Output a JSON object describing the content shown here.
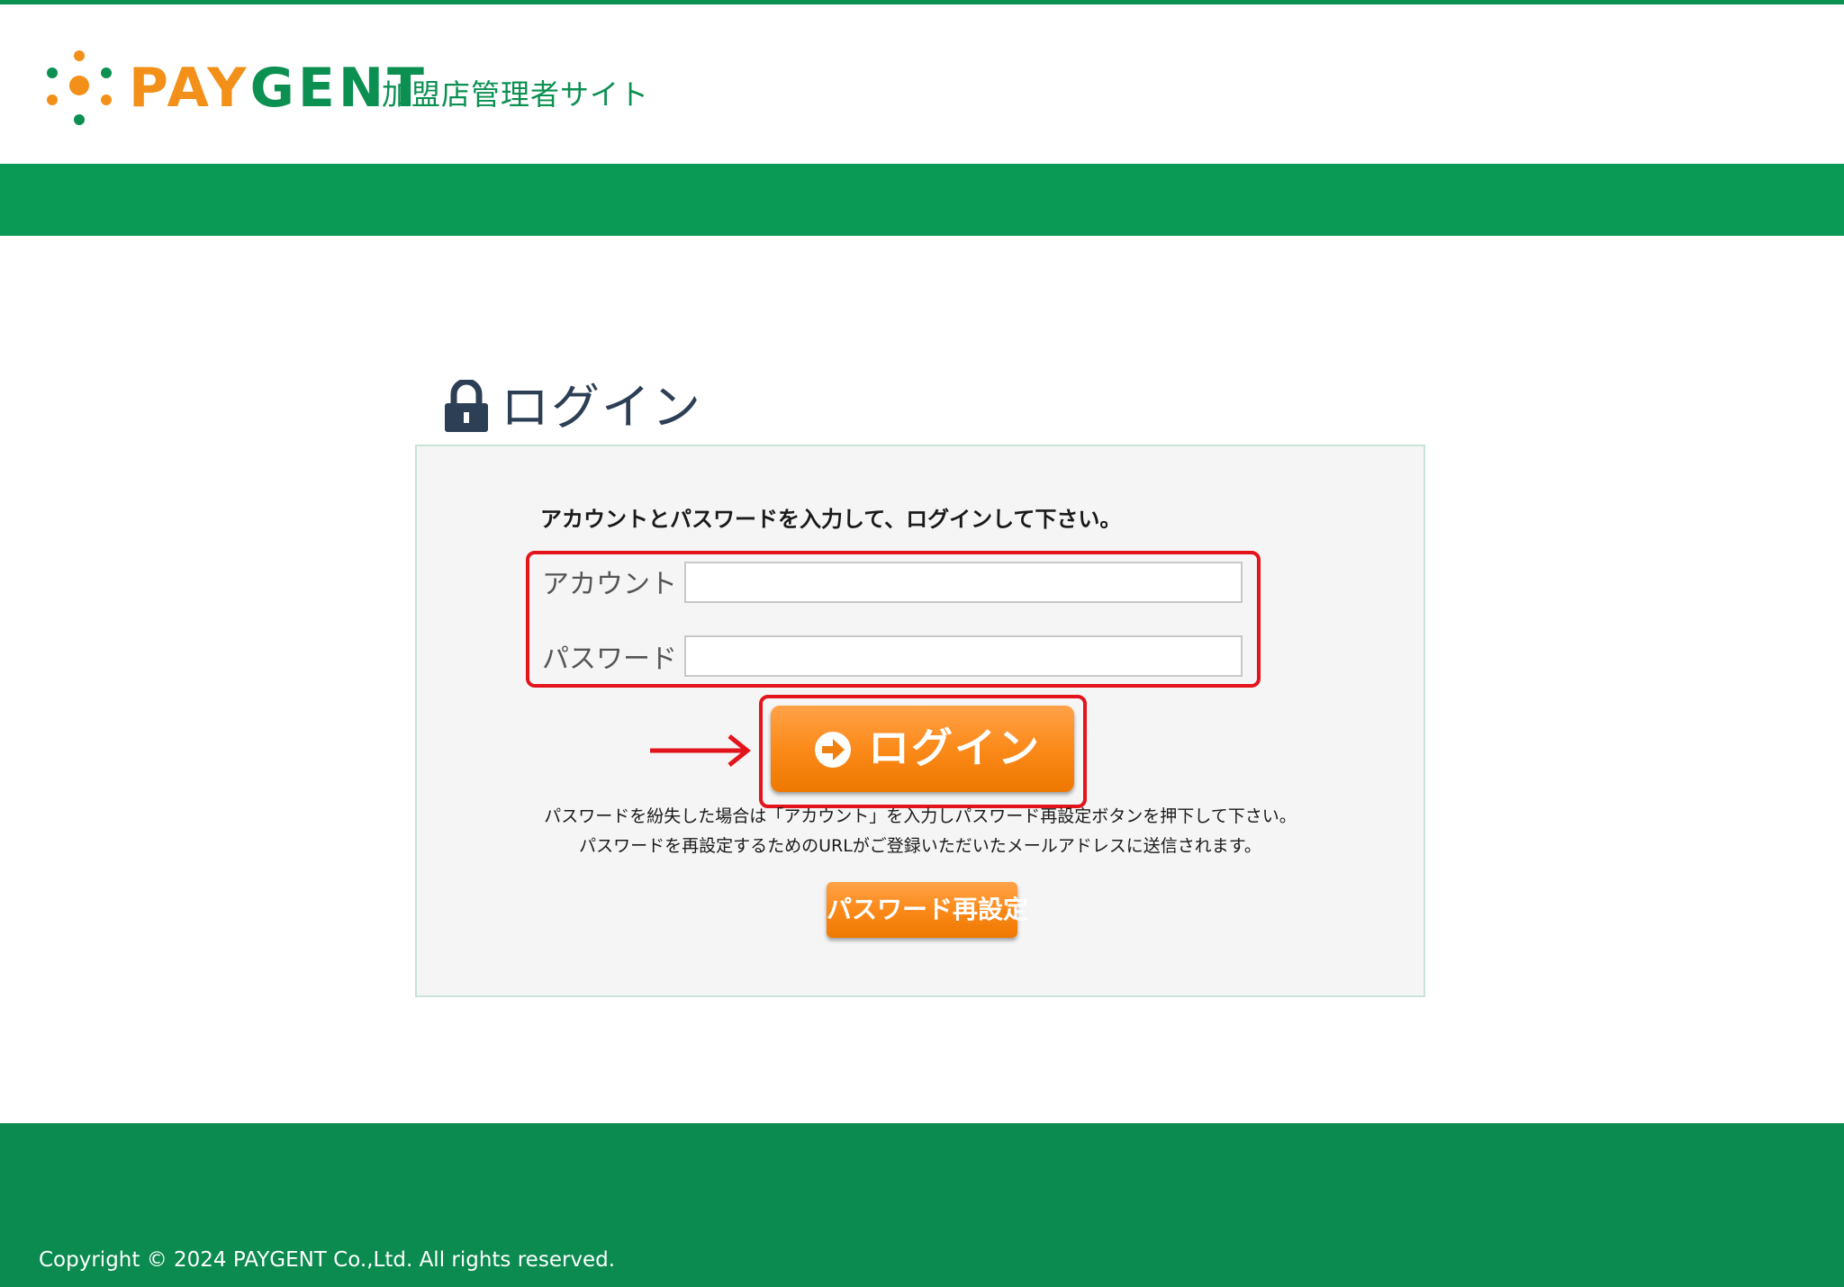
{
  "brand": {
    "logo_part1": "PAY",
    "logo_part2": "GENT",
    "site_name": "加盟店管理者サイト",
    "green": "#0b9052",
    "orange": "#f39019"
  },
  "login": {
    "heading": "ログイン",
    "heading_icon": "lock-icon",
    "instruction": "アカウントとパスワードを入力して、ログインして下さい。",
    "account_label": "アカウント",
    "account_value": "",
    "password_label": "パスワード",
    "password_value": "",
    "button_label": "ログイン",
    "button_icon": "arrow-circle-right-icon",
    "note_line1": "パスワードを紛失した場合は「アカウント」を入力しパスワード再設定ボタンを押下して下さい。",
    "note_line2": "パスワードを再設定するためのURLがご登録いただいたメールアドレスに送信されます。",
    "reset_button_label": "パスワード再設定"
  },
  "annotations": {
    "highlight_color": "#e3141b"
  },
  "footer": {
    "copyright": "Copyright © 2024 PAYGENT Co.,Ltd. All rights reserved."
  }
}
